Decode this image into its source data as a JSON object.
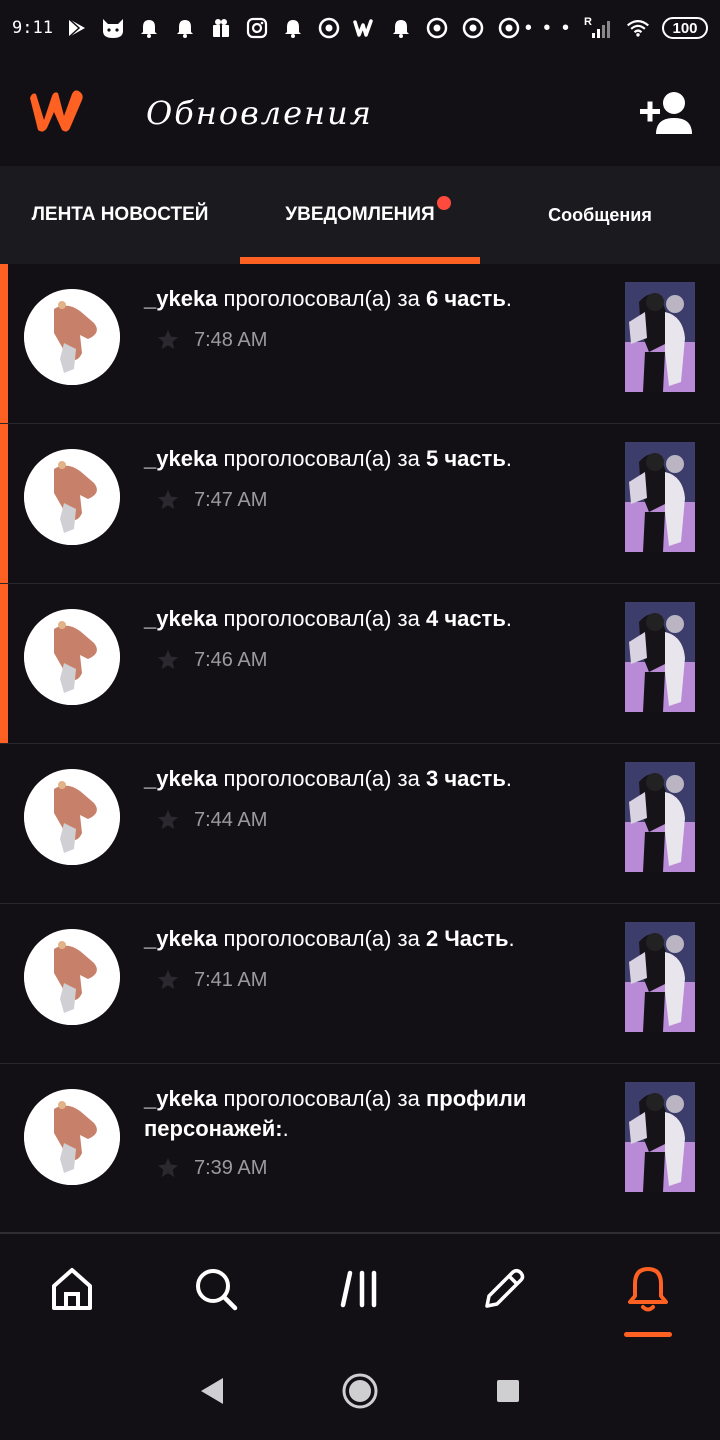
{
  "status_bar": {
    "time": "9:11",
    "signal_label": "R",
    "battery": "100",
    "more": "• • •",
    "icons": [
      "play-store-icon",
      "cat-app-icon",
      "alarm-icon",
      "alarm-icon",
      "gift-icon",
      "instagram-icon",
      "alarm-icon",
      "chrome-icon",
      "wattpad-icon",
      "alarm-icon",
      "chrome-icon",
      "chrome-icon",
      "chrome-icon"
    ]
  },
  "header": {
    "title": "Обновления",
    "accent_color": "#ff6122"
  },
  "tabs": [
    {
      "label": "ЛЕНТА НОВОСТЕЙ",
      "active": false
    },
    {
      "label": "УВЕДОМЛЕНИЯ",
      "active": true,
      "has_badge": true
    },
    {
      "label": "Сообщения",
      "active": false
    }
  ],
  "notifications": [
    {
      "username": "_ykeka",
      "action": " проголосовал(а) за ",
      "part": "6 часть",
      "suffix": ".",
      "time": "7:48 AM",
      "unread": true
    },
    {
      "username": "_ykeka",
      "action": " проголосовал(а) за ",
      "part": "5 часть",
      "suffix": ".",
      "time": "7:47 AM",
      "unread": true
    },
    {
      "username": "_ykeka",
      "action": " проголосовал(а) за ",
      "part": "4 часть",
      "suffix": ".",
      "time": "7:46 AM",
      "unread": true
    },
    {
      "username": "_ykeka",
      "action": " проголосовал(а) за ",
      "part": "3 часть",
      "suffix": ".",
      "time": "7:44 AM",
      "unread": false
    },
    {
      "username": "_ykeka",
      "action": " проголосовал(а) за ",
      "part": "2 Часть",
      "suffix": ".",
      "time": "7:41 AM",
      "unread": false
    },
    {
      "username": "_ykeka",
      "action": " проголосовал(а) за ",
      "part": "профили персонажей:",
      "suffix": ".",
      "time": "7:39 AM",
      "unread": false
    }
  ],
  "bottom_nav": [
    {
      "icon": "home-icon",
      "active": false
    },
    {
      "icon": "search-icon",
      "active": false
    },
    {
      "icon": "library-icon",
      "active": false
    },
    {
      "icon": "pencil-icon",
      "active": false
    },
    {
      "icon": "bell-icon",
      "active": true
    }
  ],
  "system_nav": [
    "back-icon",
    "home-circle-icon",
    "recents-icon"
  ]
}
